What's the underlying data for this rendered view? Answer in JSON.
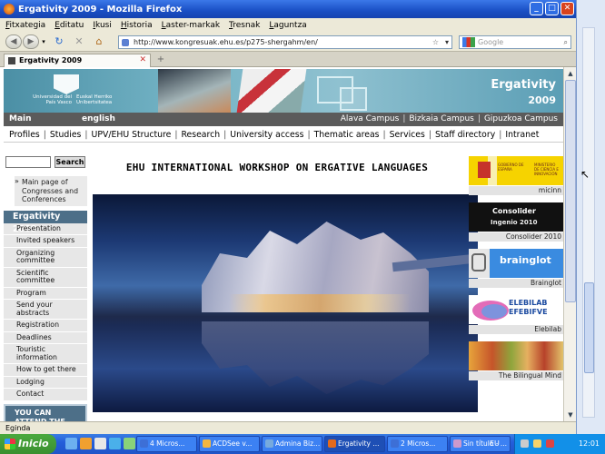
{
  "window": {
    "title": "Ergativity 2009 - Mozilla Firefox"
  },
  "menu": [
    "Fitxategia",
    "Editatu",
    "Ikusi",
    "Historia",
    "Laster-markak",
    "Tresnak",
    "Laguntza"
  ],
  "nav": {
    "url": "http://www.kongresuak.ehu.es/p275-shergahm/en/",
    "search_placeholder": "Google"
  },
  "tab": {
    "label": "Ergativity 2009"
  },
  "banner": {
    "uni_left": "Universidad del País Vasco",
    "uni_right": "Euskal Herriko Unibertsitatea",
    "title": "Ergativity",
    "year": "2009"
  },
  "langbar": {
    "main": "Main",
    "english": "english",
    "campuses": [
      "Alava Campus",
      "Bizkaia Campus",
      "Gipuzkoa Campus"
    ]
  },
  "topnav": [
    "Profiles",
    "Studies",
    "UPV/EHU Structure",
    "Research",
    "University access",
    "Thematic areas",
    "Services",
    "Staff directory",
    "Intranet"
  ],
  "sidebar": {
    "search_button": "Search",
    "congress_link": "Main page of Congresses and Conferences",
    "section_title": "Ergativity 2009",
    "items": [
      "Presentation",
      "Invited speakers",
      "Organizing committee",
      "Scientific committee",
      "Program",
      "Send your abstracts",
      "Registration",
      "Deadlines",
      "Touristic information",
      "How to get there",
      "Lodging",
      "Contact"
    ],
    "online": "YOU CAN ATTEND THE CONFERENCE ONLINE!!!"
  },
  "main": {
    "title": "EHU INTERNATIONAL WORKSHOP ON ERGATIVE LANGUAGES"
  },
  "sponsors": [
    {
      "caption": "micinn",
      "text": "GOBIERNO DE ESPAÑA",
      "text2": "MINISTERIO DE CIENCIA E INNOVACIÓN"
    },
    {
      "caption": "Consolider 2010",
      "text": "Consolider",
      "text2": "Ingenio 2010"
    },
    {
      "caption": "Brainglot",
      "text": "brainglot"
    },
    {
      "caption": "Elebilab",
      "text": "ELEBILAB EFEBIFVE"
    },
    {
      "caption": "The Bilingual Mind"
    }
  ],
  "status": {
    "text": "Eginda"
  },
  "taskbar": {
    "start": "Inicio",
    "tasks": [
      "4 Micros...",
      "ACDSee v...",
      "Admina Biz...",
      "Ergativity ...",
      "2 Micros...",
      "Sin título - ...",
      "..."
    ],
    "lang": "EU",
    "clock": "12:01"
  }
}
